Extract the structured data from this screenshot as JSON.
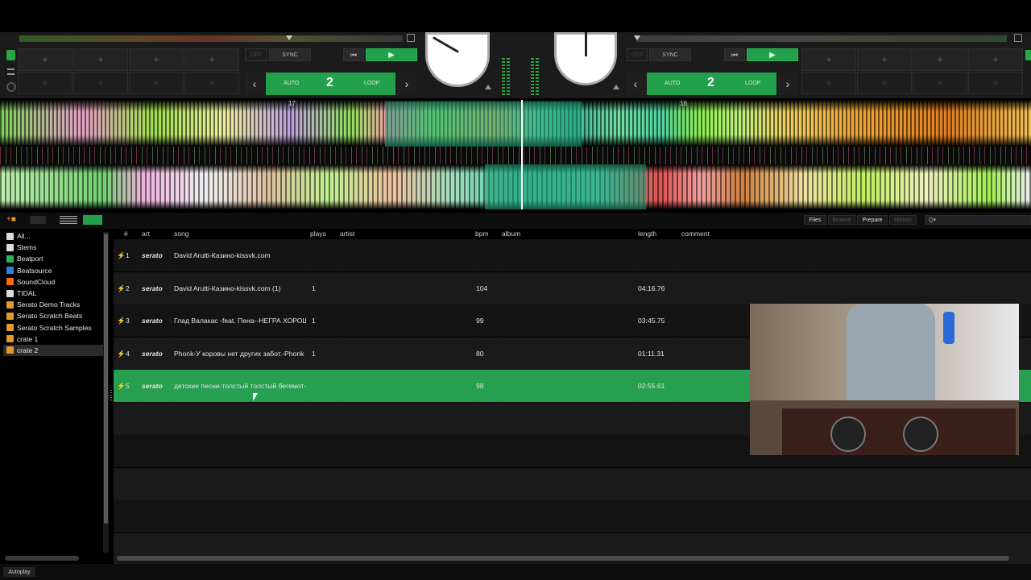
{
  "decks": {
    "left": {
      "sync_label": "SYNC",
      "loop_mode_label": "AUTO",
      "loop_value": "2",
      "loop_label": "LOOP",
      "off_label": "OFF",
      "beat_marker": "17"
    },
    "right": {
      "sync_label": "SYNC",
      "loop_mode_label": "AUTO",
      "loop_value": "2",
      "loop_label": "LOOP",
      "off_label": "OFF",
      "beat_marker": "16"
    },
    "cue_placeholder": "+"
  },
  "library_toolbar": {
    "files_label": "Files",
    "browse_label": "Browse",
    "prepare_label": "Prepare",
    "history_label": "History",
    "search_placeholder": "Q▾"
  },
  "sidebar": {
    "items": [
      {
        "label": "All...",
        "icon": "all-icon",
        "color": "#dddddd"
      },
      {
        "label": "Stems",
        "icon": "stems-icon",
        "color": "#dddddd"
      },
      {
        "label": "Beatport",
        "icon": "beatport-icon",
        "color": "#2bb35a"
      },
      {
        "label": "Beatsource",
        "icon": "beatsource-icon",
        "color": "#2f7fe0"
      },
      {
        "label": "SoundCloud",
        "icon": "soundcloud-icon",
        "color": "#ff6a00"
      },
      {
        "label": "TIDAL",
        "icon": "tidal-icon",
        "color": "#dddddd"
      },
      {
        "label": "Serato Demo Tracks",
        "icon": "crate-icon",
        "color": "#e39a2a"
      },
      {
        "label": "Serato Scratch Beats",
        "icon": "crate-icon",
        "color": "#e39a2a"
      },
      {
        "label": "Serato Scratch Samples",
        "icon": "crate-icon",
        "color": "#e39a2a"
      },
      {
        "label": "crate 1",
        "icon": "crate-icon",
        "color": "#e39a2a"
      },
      {
        "label": "crate 2",
        "icon": "crate-icon",
        "color": "#e39a2a"
      }
    ]
  },
  "table": {
    "headers": {
      "num": "#",
      "art": "art",
      "song": "song",
      "plays": "plays",
      "artist": "artist",
      "bpm": "bpm",
      "album": "album",
      "length": "length",
      "comment": "comment"
    },
    "art_text": "serato",
    "rows": [
      {
        "num": "1",
        "song": "David Arutti-Казино-kissvk.com",
        "plays": "",
        "bpm": "",
        "length": ""
      },
      {
        "num": "2",
        "song": "David Arutti-Казино-kissvk.com (1)",
        "plays": "1",
        "bpm": "104",
        "length": "04:16.76"
      },
      {
        "num": "3",
        "song": "Глад Валакас -feat. Пена--НЕГРА ХОРОШ",
        "plays": "1",
        "bpm": "99",
        "length": "03:45.75"
      },
      {
        "num": "4",
        "song": "Phonk-У коровы нет других забот.-Phonk",
        "plays": "1",
        "bpm": "80",
        "length": "01:11.31"
      },
      {
        "num": "5",
        "song": "детские песни-толстый толстый бегемот-",
        "plays": "",
        "bpm": "98",
        "length": "02:55.61"
      }
    ]
  },
  "footer": {
    "autoplay_label": "Autoplay"
  },
  "colors": {
    "accent": "#22a04b",
    "bg": "#111111",
    "crate": "#e39a2a"
  }
}
